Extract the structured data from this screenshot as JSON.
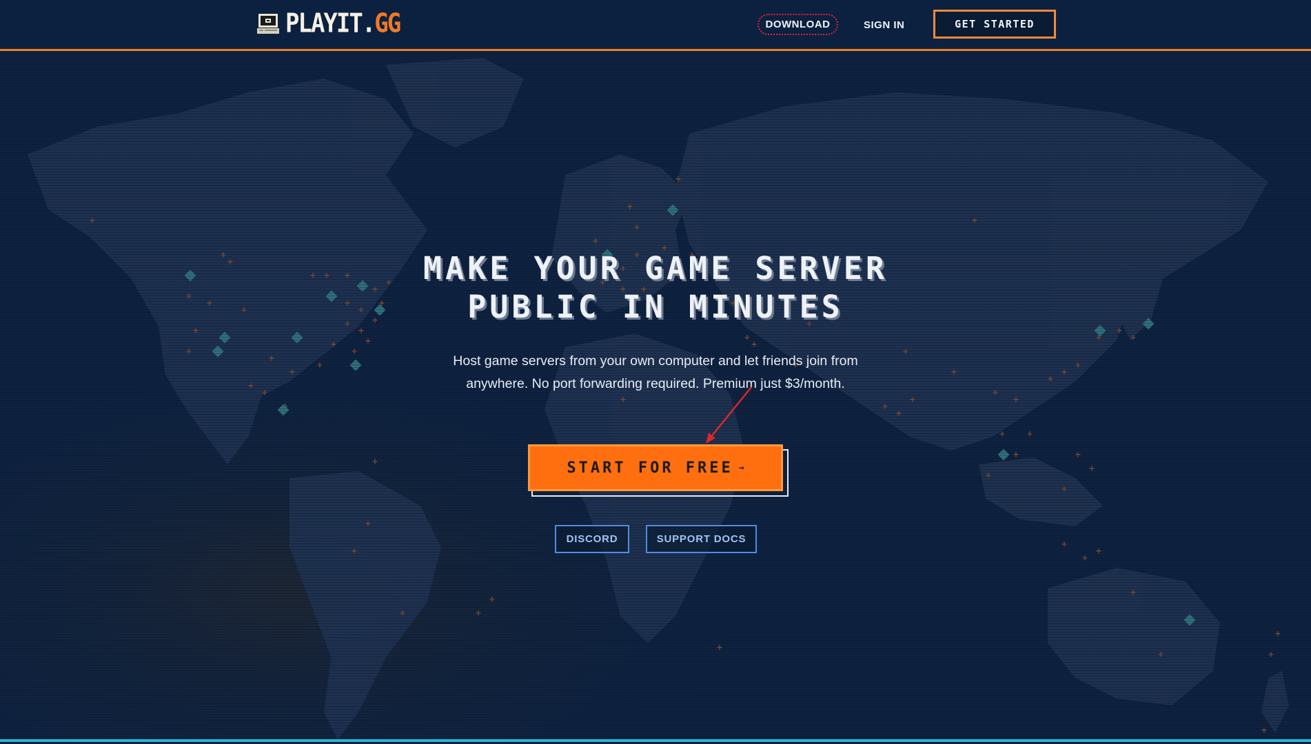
{
  "header": {
    "logo_main": "PLAYIT.",
    "logo_accent": "GG",
    "logo_icon": "retro-computer-icon",
    "nav": {
      "download": "DOWNLOAD",
      "sign_in": "SIGN IN",
      "get_started": "GET STARTED"
    }
  },
  "hero": {
    "title_line1": "MAKE YOUR GAME SERVER",
    "title_line2": "PUBLIC IN MINUTES",
    "subtitle": "Host game servers from your own computer and let friends join from anywhere. No port forwarding required. Premium just $3/month.",
    "cta_label": "START FOR FREE",
    "cta_arrow": "→",
    "discord_label": "DISCORD",
    "docs_label": "SUPPORT DOCS"
  },
  "colors": {
    "background": "#0d2341",
    "accent_orange": "#ff6f0f",
    "header_border": "#f07a28",
    "link_blue": "#4f8de0",
    "download_outline": "#e8243c",
    "bottom_line": "#2fb4d6"
  }
}
